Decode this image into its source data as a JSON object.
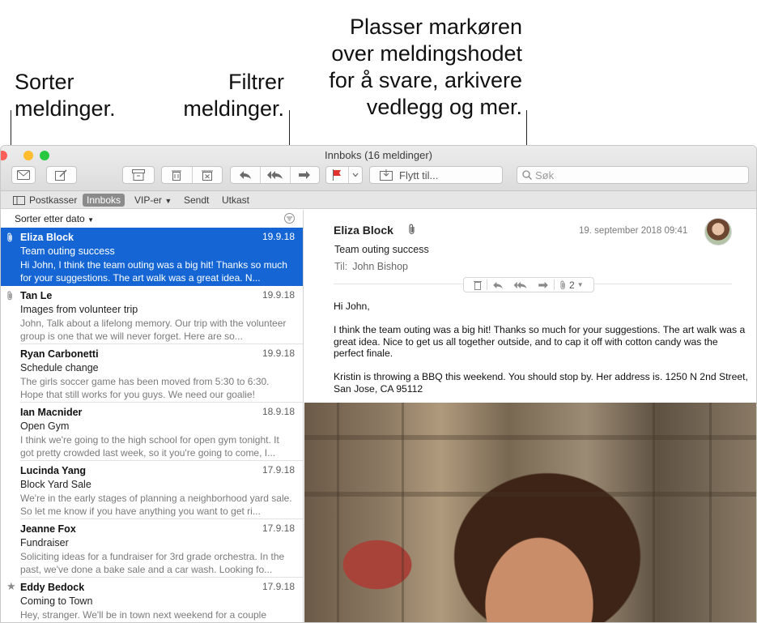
{
  "callouts": {
    "sort": [
      "Sorter",
      "meldinger."
    ],
    "filter": [
      "Filtrer",
      "meldinger."
    ],
    "hover": [
      "Plasser markøren",
      "over meldingshodet",
      "for å svare, arkivere",
      "vedlegg og mer."
    ]
  },
  "window": {
    "title": "Innboks (16 meldinger)",
    "traffic_colors": [
      "#ff5f57",
      "#febc2e",
      "#28c840"
    ]
  },
  "toolbar": {
    "move_label": "Flytt til...",
    "search_placeholder": "Søk",
    "flag_color": "#e0332d"
  },
  "favorites": [
    "Postkasser",
    "Innboks",
    "VIP-er",
    "Sendt",
    "Utkast"
  ],
  "list": {
    "sort_label": "Sorter etter dato",
    "selected_color": "#1566d4",
    "messages": [
      {
        "sender": "Eliza Block",
        "date": "19.9.18",
        "subject": "Team outing success",
        "preview": "Hi John, I think the team outing was a big hit! Thanks so much for your suggestions. The art walk was a great idea. N...",
        "mark": "attachment"
      },
      {
        "sender": "Tan Le",
        "date": "19.9.18",
        "subject": "Images from volunteer trip",
        "preview": "John, Talk about a lifelong memory. Our trip with the volunteer group is one that we will never forget. Here are so...",
        "mark": "attachment"
      },
      {
        "sender": "Ryan Carbonetti",
        "date": "19.9.18",
        "subject": "Schedule change",
        "preview": "The girls soccer game has been moved from 5:30 to 6:30. Hope that still works for you guys. We need our goalie!",
        "mark": ""
      },
      {
        "sender": "Ian Macnider",
        "date": "18.9.18",
        "subject": "Open Gym",
        "preview": "I think we're going to the high school for open gym tonight. It got pretty crowded last week, so it you're going to come, I...",
        "mark": ""
      },
      {
        "sender": "Lucinda Yang",
        "date": "17.9.18",
        "subject": "Block Yard Sale",
        "preview": "We're in the early stages of planning a neighborhood yard sale. So let me know if you have anything you want to get ri...",
        "mark": ""
      },
      {
        "sender": "Jeanne Fox",
        "date": "17.9.18",
        "subject": "Fundraiser",
        "preview": "Soliciting ideas for a fundraiser for 3rd grade orchestra. In the past, we've done a bake sale and a car wash. Looking fo...",
        "mark": ""
      },
      {
        "sender": "Eddy Bedock",
        "date": "17.9.18",
        "subject": "Coming to Town",
        "preview": "Hey, stranger. We'll be in town next weekend for a couple",
        "mark": "vip"
      }
    ]
  },
  "reader": {
    "sender": "Eliza Block",
    "date": "19. september 2018 09:41",
    "subject": "Team outing success",
    "to_label": "Til:",
    "to_name": "John Bishop",
    "attachment_count": "2",
    "body": [
      "Hi John,",
      "I think the team outing was a big hit! Thanks so much for your suggestions. The art walk was a great idea. Nice to get us all together outside, and to cap it off with cotton candy was the perfect finale.",
      "Kristin is throwing a BBQ this weekend. You should stop by. Her address is. 1250 N 2nd Street, San Jose, CA 95112"
    ]
  }
}
